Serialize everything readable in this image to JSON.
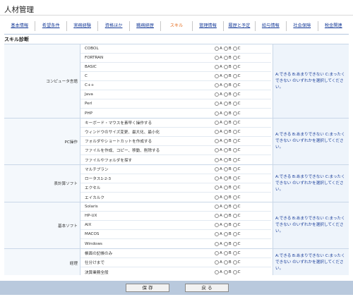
{
  "page": {
    "title": "人材管理"
  },
  "tabs": [
    {
      "label": "基本情報",
      "active": false
    },
    {
      "label": "希望条件",
      "active": false
    },
    {
      "label": "実務経験",
      "active": false
    },
    {
      "label": "資格ほか",
      "active": false
    },
    {
      "label": "職務経歴",
      "active": false
    },
    {
      "label": "スキル",
      "active": true
    },
    {
      "label": "管理情報",
      "active": false
    },
    {
      "label": "履歴と予定",
      "active": false
    },
    {
      "label": "給与情報",
      "active": false
    },
    {
      "label": "社会保険",
      "active": false
    },
    {
      "label": "税金関連",
      "active": false
    }
  ],
  "section": {
    "title": "スキル診断"
  },
  "radio_options": [
    "A",
    "B",
    "C"
  ],
  "note_text": "A:できる B:あまりできない C:まったくできない のいずれかを選択してください。",
  "groups": [
    {
      "label": "コンピュータ言語",
      "skills": [
        "COBOL",
        "FORTRAN",
        "BASIC",
        "C",
        "C++",
        "Java",
        "Perl",
        "PHP"
      ]
    },
    {
      "label": "PC操作",
      "skills": [
        "キーボード・マウスを素早く操作する",
        "ウィンドウのサイズ変更、最大化、最小化",
        "フォルダやショートカットを作成する",
        "ファイルを作成、コピー、移動、削除する",
        "ファイルやフォルダを探す"
      ]
    },
    {
      "label": "表計算ソフト",
      "skills": [
        "マルチプラン",
        "ロータス1-2-3",
        "エクセル",
        "エイカルク"
      ]
    },
    {
      "label": "基本ソフト",
      "skills": [
        "Solaris",
        "HP-UX",
        "AIX",
        "MACOS",
        "Windows"
      ]
    },
    {
      "label": "経理",
      "skills": [
        "帳面の記帳のみ",
        "仕分けまで",
        "決算業務全般"
      ]
    }
  ],
  "footer": {
    "save_label": "保 存",
    "back_label": "戻 る"
  }
}
